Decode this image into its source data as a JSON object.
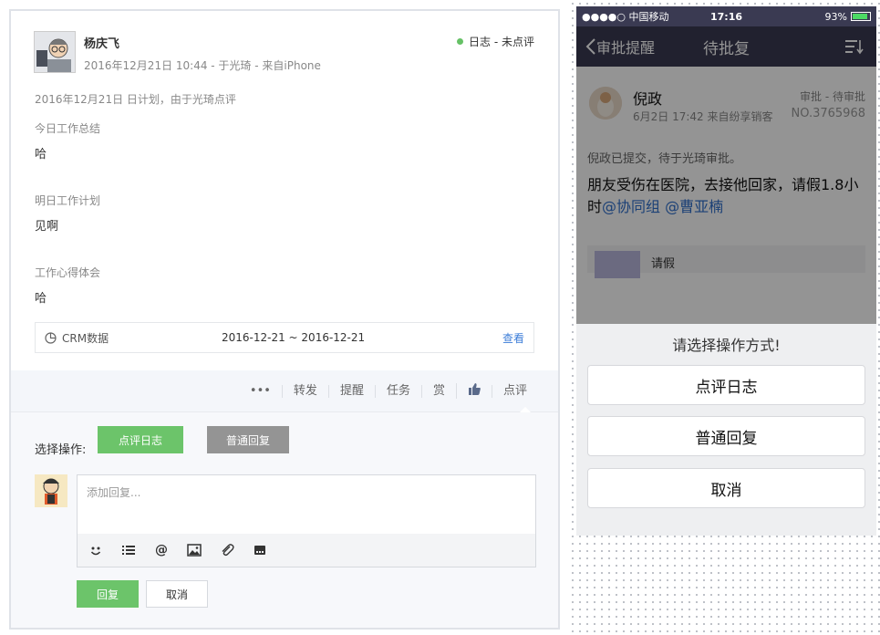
{
  "web": {
    "author": "杨庆飞",
    "meta": "2016年12月21日 10:44 - 于光琦 - 来自iPhone",
    "status": "日志 - 未点评",
    "plan_line": "2016年12月21日 日计划，由于光琦点评",
    "sections": [
      {
        "label": "今日工作总结",
        "value": "哈"
      },
      {
        "label": "明日工作计划",
        "value": "见啊"
      },
      {
        "label": "工作心得体会",
        "value": "哈"
      }
    ],
    "crm": {
      "label": "CRM数据",
      "range": "2016-12-21 ~ 2016-12-21",
      "link": "查看"
    },
    "actions": {
      "more": "•••",
      "forward": "转发",
      "remind": "提醒",
      "task": "任务",
      "reward": "赏",
      "comment": "点评"
    },
    "reply": {
      "choose_label": "选择操作:",
      "comment_log": "点评日志",
      "normal_reply": "普通回复",
      "placeholder": "添加回复...",
      "submit": "回复",
      "cancel": "取消"
    }
  },
  "phone": {
    "status_bar": {
      "carrier": "●●●●○ 中国移动",
      "time": "17:16",
      "battery": "93%"
    },
    "nav": {
      "back": "审批提醒",
      "title": "待批复"
    },
    "item": {
      "name": "倪政",
      "meta": "6月2日 17:42  来自纷享销客",
      "category": "审批 - 待审批",
      "number": "NO.3765968",
      "subtitle": "倪政已提交，待于光琦审批。",
      "body": "朋友受伤在医院，去接他回家，请假1.8小时",
      "mentions": "@协同组 @曹亚楠",
      "card_label": "请假"
    },
    "sheet": {
      "title": "请选择操作方式!",
      "options": [
        "点评日志",
        "普通回复",
        "取消"
      ]
    }
  }
}
